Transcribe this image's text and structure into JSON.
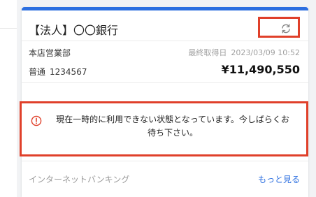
{
  "card": {
    "bank_name": "【法人】〇〇銀行",
    "branch": "本店営業部",
    "last_updated_label": "最終取得日",
    "last_updated_value": "2023/03/09 10:52",
    "account_type": "普通",
    "account_number": "1234567",
    "balance": "¥11,490,550",
    "refresh_icon": "refresh-icon",
    "error_icon": "alert-circle-icon",
    "error_message": "現在一時的に利用できない状態となっています。今しばらくお待ち下さい。",
    "footer_label": "インターネットバンキング",
    "more_link": "もっと見る"
  },
  "colors": {
    "accent_bar": "#2c6fe0",
    "highlight_border": "#e0402a",
    "error_icon": "#e0402a",
    "link": "#2c6fe0"
  }
}
